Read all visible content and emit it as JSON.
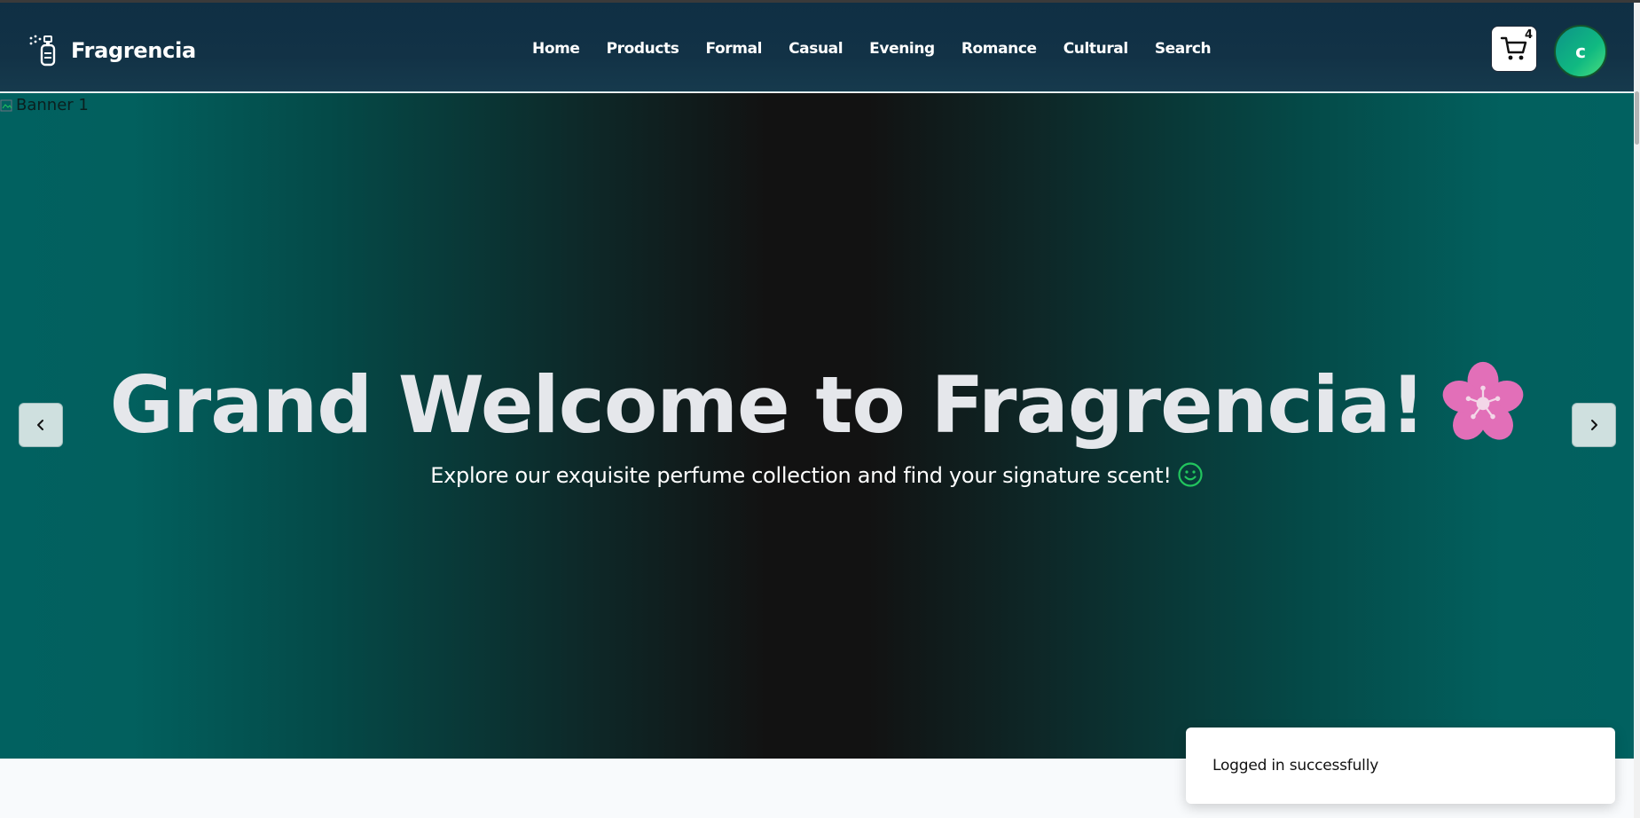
{
  "brand": {
    "name": "Fragrencia",
    "icon": "perfume-bottle-icon"
  },
  "nav": {
    "links": [
      "Home",
      "Products",
      "Formal",
      "Casual",
      "Evening",
      "Romance",
      "Cultural",
      "Search"
    ]
  },
  "cart": {
    "count": "4",
    "icon": "cart-icon"
  },
  "user": {
    "initial": "c"
  },
  "hero": {
    "image_alt": "Banner 1",
    "title": "Grand Welcome to Fragrencia!",
    "subtitle": "Explore our exquisite perfume collection and find your signature scent!",
    "prev_icon": "chevron-left-icon",
    "next_icon": "chevron-right-icon"
  },
  "toast": {
    "message": "Logged in successfully"
  },
  "colors": {
    "nav_bg": "#123246",
    "hero_edge": "#016160",
    "hero_center": "#121212",
    "flower": "#e26fb8",
    "smile": "#22c55e"
  }
}
